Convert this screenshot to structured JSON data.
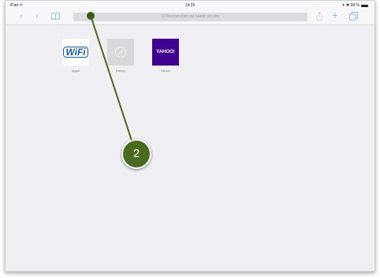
{
  "status_bar": {
    "device": "iPad ᯤ",
    "time": "14:39",
    "battery": "✦ ✱ 98 %"
  },
  "toolbar": {
    "back_icon": "‹",
    "forward_icon": "›",
    "bookmarks_icon": "📖",
    "address_placeholder": "Q Rechercher ou saisir un site",
    "share_icon": "⇧",
    "new_tab_icon": "+",
    "tabs_icon": "⧉",
    "accent_color": "#8fb8ee"
  },
  "favorites": [
    {
      "label": "Apple",
      "tile_text": "WiFi"
    },
    {
      "label": "Disney",
      "tile_text": "⌀"
    },
    {
      "label": "Yahoo!",
      "tile_text": "YAHOO!"
    }
  ],
  "annotation": {
    "number": "2",
    "color": "#4a6b1f"
  }
}
